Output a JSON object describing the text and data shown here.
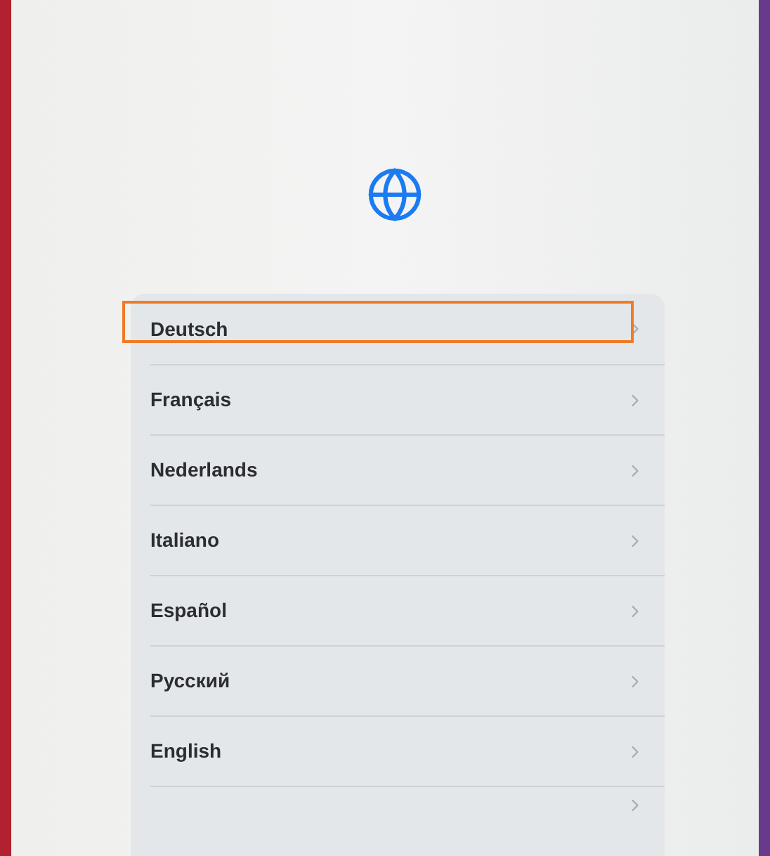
{
  "languages": [
    {
      "label": "Deutsch",
      "selected": true
    },
    {
      "label": "Français",
      "selected": false
    },
    {
      "label": "Nederlands",
      "selected": false
    },
    {
      "label": "Italiano",
      "selected": false
    },
    {
      "label": "Español",
      "selected": false
    },
    {
      "label": "Русский",
      "selected": false
    },
    {
      "label": "English",
      "selected": false
    },
    {
      "selected": false
    }
  ]
}
